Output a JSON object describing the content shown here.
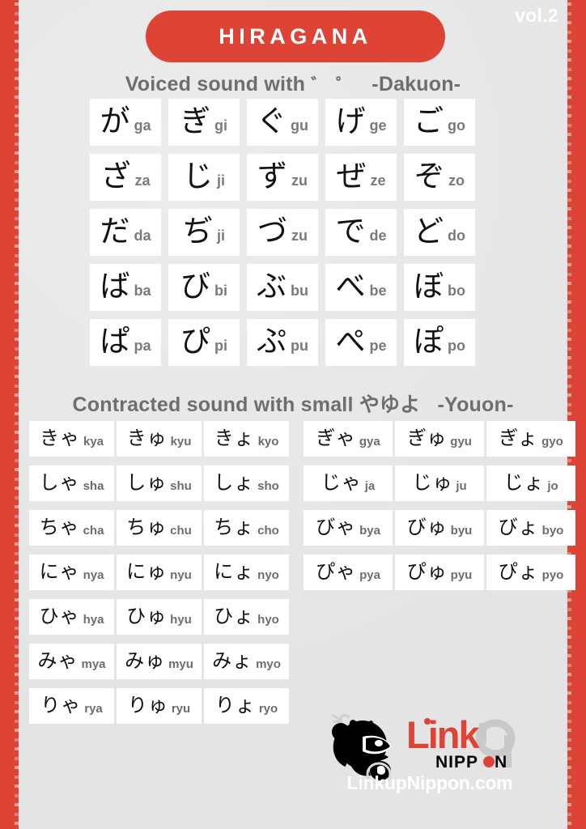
{
  "header": {
    "title": "HIRAGANA",
    "volume": "vol.2"
  },
  "dakuon": {
    "heading_prefix": "Voiced sound with",
    "heading_marks": "゛ ゜",
    "heading_name": "-Dakuon-",
    "rows": [
      [
        {
          "kana": "が",
          "romaji": "ga"
        },
        {
          "kana": "ぎ",
          "romaji": "gi"
        },
        {
          "kana": "ぐ",
          "romaji": "gu"
        },
        {
          "kana": "げ",
          "romaji": "ge"
        },
        {
          "kana": "ご",
          "romaji": "go"
        }
      ],
      [
        {
          "kana": "ざ",
          "romaji": "za"
        },
        {
          "kana": "じ",
          "romaji": "ji"
        },
        {
          "kana": "ず",
          "romaji": "zu"
        },
        {
          "kana": "ぜ",
          "romaji": "ze"
        },
        {
          "kana": "ぞ",
          "romaji": "zo"
        }
      ],
      [
        {
          "kana": "だ",
          "romaji": "da"
        },
        {
          "kana": "ぢ",
          "romaji": "ji"
        },
        {
          "kana": "づ",
          "romaji": "zu"
        },
        {
          "kana": "で",
          "romaji": "de"
        },
        {
          "kana": "ど",
          "romaji": "do"
        }
      ],
      [
        {
          "kana": "ば",
          "romaji": "ba"
        },
        {
          "kana": "び",
          "romaji": "bi"
        },
        {
          "kana": "ぶ",
          "romaji": "bu"
        },
        {
          "kana": "べ",
          "romaji": "be"
        },
        {
          "kana": "ぼ",
          "romaji": "bo"
        }
      ],
      [
        {
          "kana": "ぱ",
          "romaji": "pa"
        },
        {
          "kana": "ぴ",
          "romaji": "pi"
        },
        {
          "kana": "ぷ",
          "romaji": "pu"
        },
        {
          "kana": "ぺ",
          "romaji": "pe"
        },
        {
          "kana": "ぽ",
          "romaji": "po"
        }
      ]
    ]
  },
  "youon": {
    "heading_prefix": "Contracted sound with small",
    "heading_kana": "やゆよ",
    "heading_name": "-Youon-",
    "left_rows": [
      [
        {
          "kana": "きゃ",
          "romaji": "kya"
        },
        {
          "kana": "きゅ",
          "romaji": "kyu"
        },
        {
          "kana": "きょ",
          "romaji": "kyo"
        }
      ],
      [
        {
          "kana": "しゃ",
          "romaji": "sha"
        },
        {
          "kana": "しゅ",
          "romaji": "shu"
        },
        {
          "kana": "しょ",
          "romaji": "sho"
        }
      ],
      [
        {
          "kana": "ちゃ",
          "romaji": "cha"
        },
        {
          "kana": "ちゅ",
          "romaji": "chu"
        },
        {
          "kana": "ちょ",
          "romaji": "cho"
        }
      ],
      [
        {
          "kana": "にゃ",
          "romaji": "nya"
        },
        {
          "kana": "にゅ",
          "romaji": "nyu"
        },
        {
          "kana": "にょ",
          "romaji": "nyo"
        }
      ],
      [
        {
          "kana": "ひゃ",
          "romaji": "hya"
        },
        {
          "kana": "ひゅ",
          "romaji": "hyu"
        },
        {
          "kana": "ひょ",
          "romaji": "hyo"
        }
      ],
      [
        {
          "kana": "みゃ",
          "romaji": "mya"
        },
        {
          "kana": "みゅ",
          "romaji": "myu"
        },
        {
          "kana": "みょ",
          "romaji": "myo"
        }
      ],
      [
        {
          "kana": "りゃ",
          "romaji": "rya"
        },
        {
          "kana": "りゅ",
          "romaji": "ryu"
        },
        {
          "kana": "りょ",
          "romaji": "ryo"
        }
      ]
    ],
    "right_rows": [
      [
        {
          "kana": "ぎゃ",
          "romaji": "gya"
        },
        {
          "kana": "ぎゅ",
          "romaji": "gyu"
        },
        {
          "kana": "ぎょ",
          "romaji": "gyo"
        }
      ],
      [
        {
          "kana": "じゃ",
          "romaji": "ja"
        },
        {
          "kana": "じゅ",
          "romaji": "ju"
        },
        {
          "kana": "じょ",
          "romaji": "jo"
        }
      ],
      [
        {
          "kana": "びゃ",
          "romaji": "bya"
        },
        {
          "kana": "びゅ",
          "romaji": "byu"
        },
        {
          "kana": "びょ",
          "romaji": "byo"
        }
      ],
      [
        {
          "kana": "ぴゃ",
          "romaji": "pya"
        },
        {
          "kana": "ぴゅ",
          "romaji": "pyu"
        },
        {
          "kana": "ぴょ",
          "romaji": "pyo"
        }
      ]
    ]
  },
  "logo": {
    "link_text": "Link",
    "up_text": "up",
    "nippon_text_left": "NIPP",
    "nippon_text_right": "N",
    "site_url": "LinkupNippon.com"
  },
  "colors": {
    "brand_red": "#dd4436",
    "background": "#e8e8e8",
    "cell": "#ffffff",
    "heading_gray": "#6e6e6e",
    "romaji_gray": "#7a7a7a",
    "kana_black": "#111111",
    "logo_up_gray": "#c9c9c9"
  }
}
